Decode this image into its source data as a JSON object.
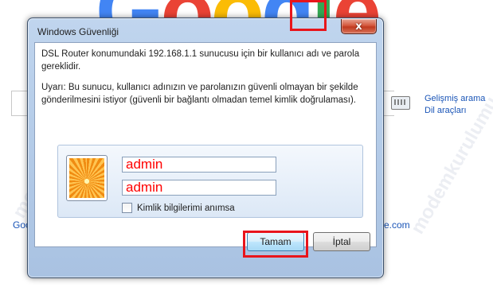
{
  "background": {
    "logo": [
      "G",
      "o",
      "o",
      "g",
      "l",
      "e"
    ],
    "advanced_links": [
      "Gelişmiş arama",
      "Dil araçları"
    ],
    "left_link_partial": "Goog",
    "right_link_partial": "e.com",
    "watermark": "modemkurulumu.com"
  },
  "dialog": {
    "title": "Windows Güvenliği",
    "close_symbol": "x",
    "message": "DSL Router konumundaki 192.168.1.1 sunucusu için bir kullanıcı adı ve parola gereklidir.",
    "warning": "Uyarı: Bu sunucu, kullanıcı adınızın ve parolanızın güvenli olmayan bir şekilde gönderilmesini istiyor (güvenli bir bağlantı olmadan temel kimlik doğrulaması).",
    "username": "admin",
    "password": "admin",
    "remember_label": "Kimlik bilgilerimi anımsa",
    "remember_checked": false,
    "ok_label": "Tamam",
    "cancel_label": "İptal"
  },
  "colors": {
    "highlight": "#e8151b",
    "credential_text": "#ff0000",
    "link": "#1a55b7"
  }
}
